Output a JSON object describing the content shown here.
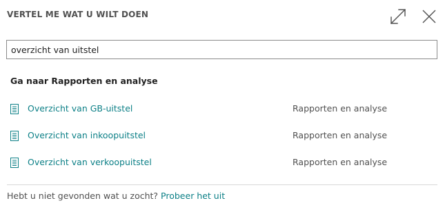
{
  "header": {
    "title": "VERTEL ME WAT U WILT DOEN",
    "expand_icon": "expand-icon",
    "close_icon": "close-icon"
  },
  "search": {
    "value": "overzicht van uitstel"
  },
  "section": {
    "title": "Ga naar Rapporten en analyse"
  },
  "results": [
    {
      "icon": "report-icon",
      "name": "Overzicht van GB-uitstel",
      "category": "Rapporten en analyse"
    },
    {
      "icon": "report-icon",
      "name": "Overzicht van inkoopuitstel",
      "category": "Rapporten en analyse"
    },
    {
      "icon": "report-icon",
      "name": "Overzicht van verkoopuitstel",
      "category": "Rapporten en analyse"
    }
  ],
  "footer": {
    "text": "Hebt u niet gevonden wat u zocht? ",
    "link": "Probeer het uit"
  },
  "colors": {
    "accent": "#0b7f86",
    "text": "#212121",
    "muted": "#505050"
  }
}
